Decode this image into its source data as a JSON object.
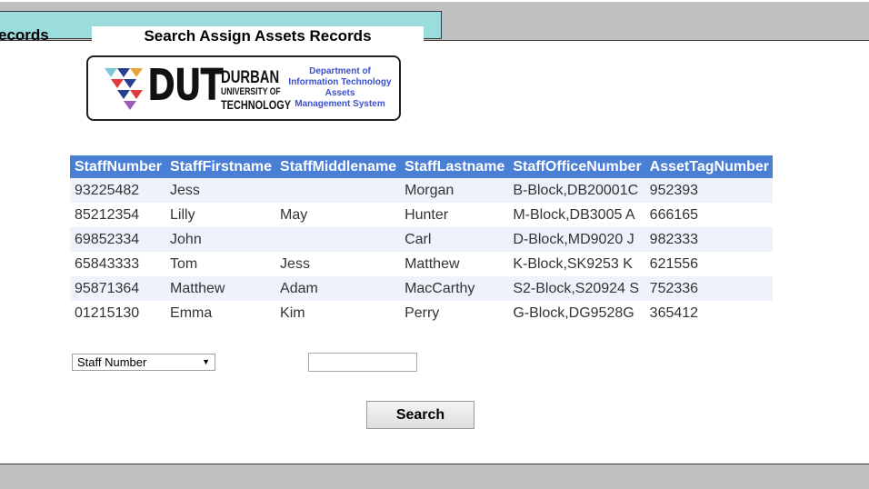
{
  "header": {
    "records_tab_label": "ecords",
    "page_title": "Search Assign Assets Records"
  },
  "logo": {
    "mark_text": "DUT",
    "name_line1": "DURBAN",
    "name_line2": "UNIVERSITY OF",
    "name_line3": "TECHNOLOGY",
    "dept_line1": "Department of",
    "dept_line2": "Information Technology",
    "dept_line3": "Assets",
    "dept_line4": "Management System"
  },
  "table": {
    "columns": [
      "StaffNumber",
      "StaffFirstname",
      "StaffMiddlename",
      "StaffLastname",
      "StaffOfficeNumber",
      "AssetTagNumber"
    ],
    "rows": [
      [
        "93225482",
        "Jess",
        "",
        "Morgan",
        "B-Block,DB20001C",
        "952393"
      ],
      [
        "85212354",
        "Lilly",
        "May",
        "Hunter",
        "M-Block,DB3005 A",
        "666165"
      ],
      [
        "69852334",
        "John",
        "",
        "Carl",
        "D-Block,MD9020 J",
        "982333"
      ],
      [
        "65843333",
        "Tom",
        "Jess",
        "Matthew",
        "K-Block,SK9253 K",
        "621556"
      ],
      [
        "95871364",
        "Matthew",
        "Adam",
        "MacCarthy",
        "S2-Block,S20924 S",
        "752336"
      ],
      [
        "01215130",
        "Emma",
        "Kim",
        "Perry",
        "G-Block,DG9528G",
        "365412"
      ]
    ]
  },
  "search": {
    "field_selected": "Staff Number",
    "input_value": "",
    "button_label": "Search"
  },
  "colors": {
    "table_header": "#4a7fd6",
    "tab_cyan": "#9bdcdc",
    "toolbar_gray": "#c0c0c0",
    "dept_text": "#3a4fd0"
  }
}
